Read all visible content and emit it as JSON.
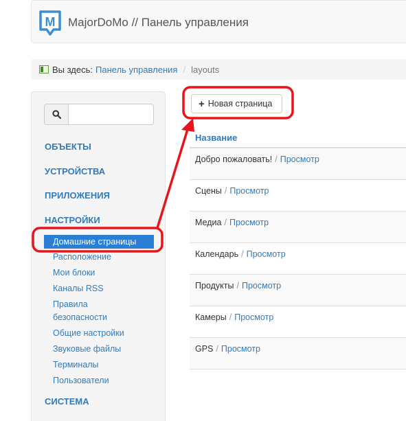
{
  "header": {
    "title": "MajorDoMo // Панель управления"
  },
  "breadcrumb": {
    "prefix": "Вы здесь:",
    "link": "Панель управления",
    "current": "layouts"
  },
  "sidebar": {
    "categories": [
      "ОБЪЕКТЫ",
      "УСТРОЙСТВА",
      "ПРИЛОЖЕНИЯ",
      "НАСТРОЙКИ",
      "СИСТЕМА"
    ],
    "settings_items": [
      "Домашние страницы",
      "Расположение",
      "Мои блоки",
      "Каналы RSS",
      "Правила",
      "безопасности",
      "Общие настройки",
      "Звуковые файлы",
      "Терминалы",
      "Пользователи"
    ]
  },
  "toolbar": {
    "new_page_label": "Новая страница"
  },
  "table": {
    "header": "Название",
    "view_label": "Просмотр",
    "rows": [
      "Добро пожаловать!",
      "Сцены",
      "Медиа",
      "Календарь",
      "Продукты",
      "Камеры",
      "GPS"
    ]
  },
  "colors": {
    "link": "#337ab7",
    "active": "#2a7fd4",
    "annotation": "#e8141c"
  }
}
